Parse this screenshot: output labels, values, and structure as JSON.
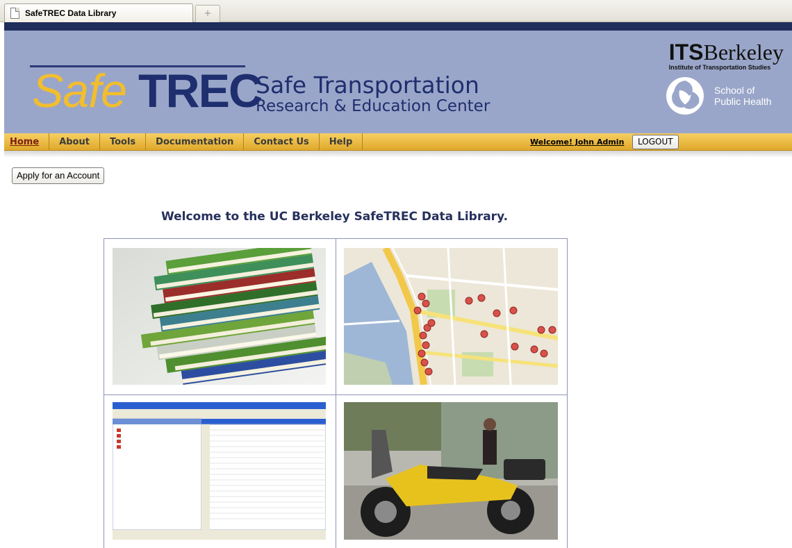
{
  "browser": {
    "tab_title": "SafeTREC Data Library",
    "new_tab_symbol": "+"
  },
  "header": {
    "logo_safe": "Safe",
    "logo_trec": "TREC",
    "subtitle_line1": "Safe Transportation",
    "subtitle_line2": "Research & Education Center",
    "its_bold": "ITS",
    "its_rest": "Berkeley",
    "its_sub": "Institute of Transportation Studies",
    "sph_line1": "School of",
    "sph_line2": "Public Health"
  },
  "nav": {
    "items": [
      "Home",
      "About",
      "Tools",
      "Documentation",
      "Contact Us",
      "Help"
    ],
    "welcome_text": "Welcome! John Admin",
    "logout_label": "LOGOUT"
  },
  "content": {
    "apply_label": "Apply for an Account",
    "welcome_title": "Welcome to the UC Berkeley SafeTREC Data Library."
  },
  "colors": {
    "banner": "#9aa6c9",
    "navy": "#1e2e6e",
    "gold": "#f2be2e",
    "nav_gradient_top": "#f6cf62",
    "nav_gradient_bottom": "#e0a92b"
  }
}
